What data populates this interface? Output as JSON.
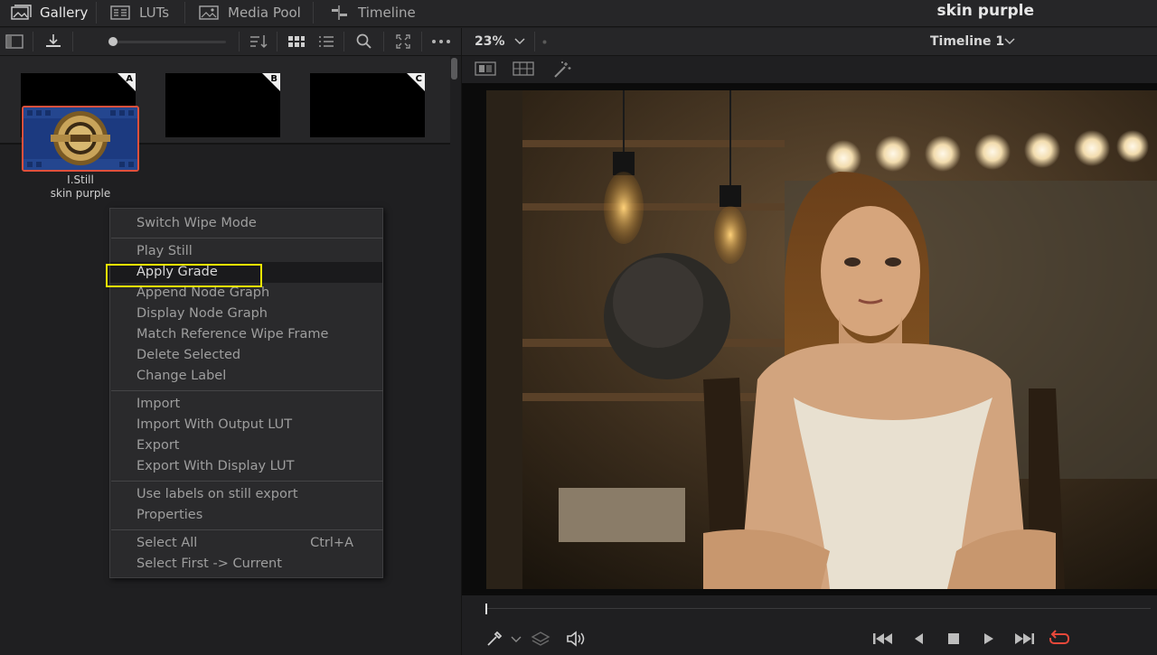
{
  "tabs": [
    {
      "label": "Gallery",
      "icon": "gallery-icon",
      "active": true
    },
    {
      "label": "LUTs",
      "icon": "luts-icon",
      "active": false
    },
    {
      "label": "Media Pool",
      "icon": "media-pool-icon",
      "active": false
    },
    {
      "label": "Timeline",
      "icon": "timeline-icon",
      "active": false
    }
  ],
  "project_title": "skin purple",
  "viewer": {
    "zoom": "23%",
    "timeline_name": "Timeline 1"
  },
  "albums": [
    {
      "label": "A"
    },
    {
      "label": "B"
    },
    {
      "label": "C"
    }
  ],
  "still": {
    "name": "I.Still",
    "label": "skin purple"
  },
  "context_menu": {
    "groups": [
      [
        {
          "label": "Switch Wipe Mode"
        }
      ],
      [
        {
          "label": "Play Still"
        },
        {
          "label": "Apply Grade",
          "highlighted": true
        },
        {
          "label": "Append Node Graph"
        },
        {
          "label": "Display Node Graph"
        },
        {
          "label": "Match Reference Wipe Frame"
        },
        {
          "label": "Delete Selected"
        },
        {
          "label": "Change Label"
        }
      ],
      [
        {
          "label": "Import"
        },
        {
          "label": "Import With Output LUT"
        },
        {
          "label": "Export"
        },
        {
          "label": "Export With Display LUT"
        }
      ],
      [
        {
          "label": "Use labels on still export"
        },
        {
          "label": "Properties"
        }
      ],
      [
        {
          "label": "Select All",
          "shortcut": "Ctrl+A"
        },
        {
          "label": "Select First -> Current"
        }
      ]
    ]
  },
  "colors": {
    "accent_highlight": "#f2e800",
    "still_border": "#e0503c",
    "loop_active": "#e8483a"
  }
}
